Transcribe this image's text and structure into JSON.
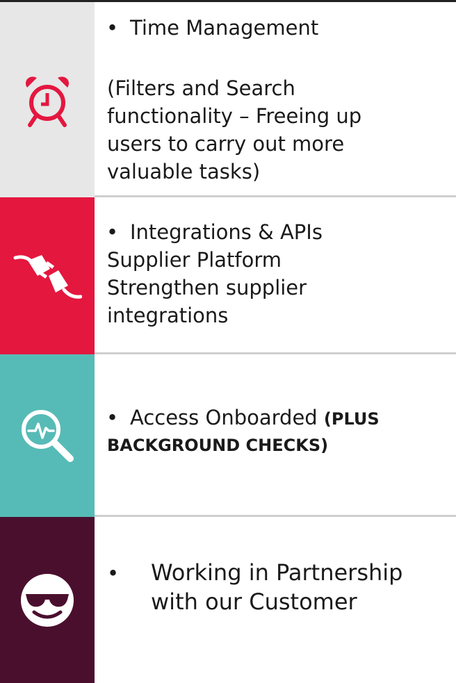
{
  "rows": [
    {
      "icon": "alarm-clock-icon",
      "bullet": "•",
      "heading": "Time Management",
      "lines": [
        "(Filters and Search",
        "functionality – Freeing up",
        "users to carry out more",
        "valuable tasks)"
      ]
    },
    {
      "icon": "plug-icon",
      "bullet": "•",
      "heading": "Integrations & APIs",
      "lines": [
        "Supplier Platform",
        "Strengthen supplier",
        "integrations"
      ]
    },
    {
      "icon": "search-pulse-icon",
      "bullet": "•",
      "heading": "Access Onboarded",
      "bold_part1": "(PLUS",
      "bold_part2": "BACKGROUND CHECKS)"
    },
    {
      "icon": "sunglasses-smiley-icon",
      "bullet": "•",
      "lines": [
        "Working in Partnership",
        "with our Customer"
      ]
    }
  ],
  "colors": {
    "row1": "#e7e7e7",
    "row2": "#e4173f",
    "row3": "#56bbb6",
    "row4": "#4b0f2e",
    "icon_red": "#e4173f",
    "icon_white": "#ffffff"
  }
}
